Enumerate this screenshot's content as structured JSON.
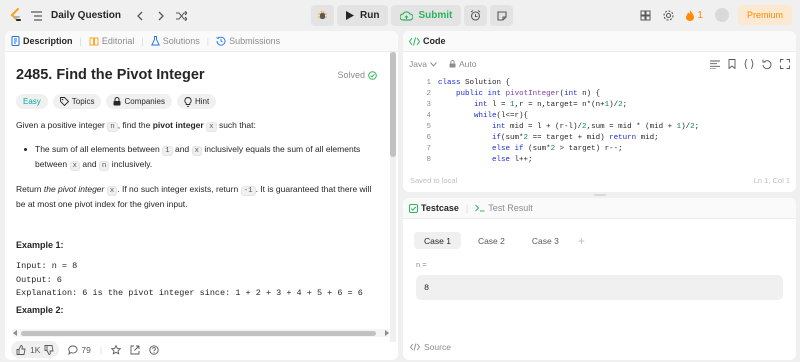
{
  "topbar": {
    "title": "Daily Question",
    "run_label": "Run",
    "submit_label": "Submit",
    "streak": "1",
    "premium_label": "Premium"
  },
  "left": {
    "tabs": [
      {
        "label": "Description"
      },
      {
        "label": "Editorial"
      },
      {
        "label": "Solutions"
      },
      {
        "label": "Submissions"
      }
    ],
    "problem_title": "2485. Find the Pivot Integer",
    "status": "Solved",
    "tags": {
      "difficulty": "Easy",
      "topics": "Topics",
      "companies": "Companies",
      "hint": "Hint"
    },
    "p1": {
      "a": "Given a positive integer ",
      "n": "n",
      "b": ", find the ",
      "bold": "pivot integer",
      "x": "x",
      "c": " such that:"
    },
    "bullet": {
      "a": "The sum of all elements between ",
      "one": "1",
      "b": " and ",
      "x": "x",
      "c": " inclusively equals the sum of all elements between ",
      "x2": "x",
      "d": " and ",
      "n": "n",
      "e": " inclusively."
    },
    "p2": {
      "a": "Return ",
      "em": "the pivot integer ",
      "x": "x",
      "b": ". If no such integer exists, return ",
      "neg": "-1",
      "c": ". It is guaranteed that there will be at most one pivot index for the given input."
    },
    "example1_title": "Example 1:",
    "example1": "Input: n = 8\nOutput: 6\nExplanation: 6 is the pivot integer since: 1 + 2 + 3 + 4 + 5 + 6 = 6",
    "example2_title": "Example 2:",
    "likes": "1K",
    "comments": "79"
  },
  "code": {
    "tab_label": "Code",
    "language": "Java",
    "mode": "Auto",
    "lines": [
      "1",
      "2",
      "3",
      "4",
      "5",
      "6",
      "7",
      "8"
    ],
    "saved": "Saved to local",
    "cursor": "Ln 1, Col 1"
  },
  "test": {
    "tab_label": "Testcase",
    "result_label": "Test Result",
    "cases": [
      "Case 1",
      "Case 2",
      "Case 3"
    ],
    "var_label": "n =",
    "value": "8",
    "source_label": "Source"
  }
}
